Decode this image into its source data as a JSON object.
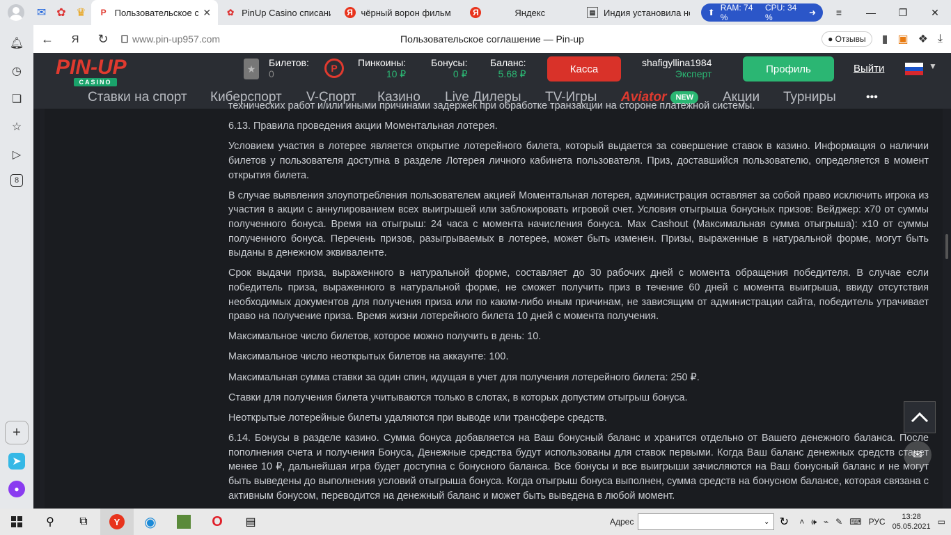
{
  "browser": {
    "tabs": [
      {
        "label": "Пользовательское с",
        "active": true
      },
      {
        "label": "PinUp Casino списание"
      },
      {
        "label": "чёрный ворон фильм с"
      },
      {
        "label": "Яндекс"
      },
      {
        "label": "Индия установила нов"
      }
    ],
    "perf": {
      "ram": "RAM: 74 %",
      "cpu": "CPU: 34 %"
    },
    "url": "www.pin-up957.com",
    "page_title": "Пользовательское соглашение — Pin-up",
    "reviews_label": "Отзывы"
  },
  "site": {
    "logo_text": "PIN-UP",
    "logo_sub": "CASINO",
    "tickets_label": "Билетов:",
    "tickets_value": "0",
    "pinkoins_label": "Пинкоины:",
    "pinkoins_value": "10 ₽",
    "bonus_label": "Бонусы:",
    "bonus_value": "0 ₽",
    "balance_label": "Баланс:",
    "balance_value": "5.68 ₽",
    "kassa_label": "Касса",
    "username": "shafigyllina1984",
    "user_level": "Эксперт",
    "profile_label": "Профиль",
    "logout_label": "Выйти",
    "nav": {
      "sport": "Ставки на спорт",
      "esport": "Киберспорт",
      "vsport": "V-Спорт",
      "casino": "Казино",
      "live": "Live Дилеры",
      "tv": "TV-Игры",
      "aviator": "Aviator",
      "new_badge": "NEW",
      "promo": "Акции",
      "tournaments": "Турниры",
      "more": "•••"
    }
  },
  "doc": {
    "cut_line": "технических работ и/или иными причинами задержек при обработке транзакции на стороне платежной системы.",
    "p1": "6.13. Правила проведения акции Моментальная лотерея.",
    "p2": "Условием участия в лотерее является открытие лотерейного билета, который выдается за совершение ставок в казино. Информация о наличии билетов у пользователя доступна в разделе Лотерея личного кабинета пользователя. Приз, доставшийся пользователю, определяется в момент открытия билета.",
    "p3": "В случае выявления злоупотребления пользователем акцией Моментальная лотерея, администрация оставляет за собой право исключить игрока из участия в акции с аннулированием всех выигрышей или заблокировать игровой счет. Условия отыгрыша бонусных призов: Вейджер: x70 от суммы полученного бонуса. Время на отыгрыш: 24 часа с момента начисления бонуса. Max Cashout (Максимальная сумма отыгрыша): x10 от суммы полученного бонуса. Перечень призов, разыгрываемых в лотерее, может быть изменен. Призы, выраженные в натуральной форме, могут быть выданы в денежном эквиваленте.",
    "p4": "Срок выдачи приза, выраженного в натуральной форме, составляет до 30 рабочих дней с момента обращения победителя. В случае если победитель приза, выраженного в натуральной форме, не сможет получить приз в течение 60 дней с момента выигрыша, ввиду отсутствия необходимых документов для получения приза или по каким-либо иным причинам, не зависящим от администрации сайта, победитель утрачивает право на получение приза. Время жизни лотерейного билета 10 дней с момента получения.",
    "p5": "Максимальное число билетов, которое можно получить в день: 10.",
    "p6": "Максимальное число неоткрытых билетов на аккаунте: 100.",
    "p7": "Максимальная сумма ставки за один спин, идущая в учет для получения лотерейного билета: 250 ₽.",
    "p8": "Ставки для получения билета учитываются только в слотах, в которых допустим отыгрыш бонуса.",
    "p9": "Неоткрытые лотерейные билеты удаляются при выводе или трансфере средств.",
    "p10": "6.14. Бонусы в разделе казино. Сумма бонуса добавляется на Ваш бонусный баланс и хранится отдельно от Вашего денежного баланса. После пополнения счета и получения Бонуса, Денежные средства будут использованы для ставок первыми. Когда Ваш баланс денежных средств станет менее 10 ₽, дальнейшая игра будет доступна с бонусного баланса. Все бонусы и все выигрыши зачисляются на Ваш бонусный баланс и не могут быть выведены до выполнения условий отыгрыша бонуса. Когда отыгрыш бонуса выполнен, сумма средств на бонусном балансе, которая связана с активным бонусом, переводится на денежный баланс и может быть выведена в любой момент."
  },
  "taskbar": {
    "address_label": "Адрес",
    "lang": "РУС",
    "time": "13:28",
    "date": "05.05.2021"
  },
  "colors": {
    "accent_green": "#2bb673",
    "accent_red": "#d93229",
    "header_bg": "#2a2d33"
  }
}
